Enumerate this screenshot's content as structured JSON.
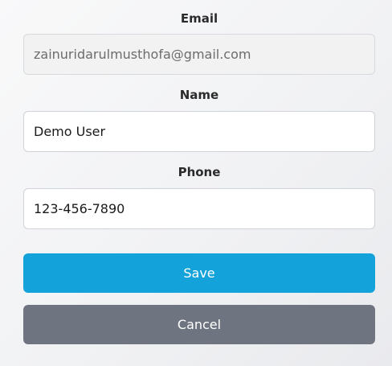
{
  "form": {
    "email": {
      "label": "Email",
      "value": "zainuridarulmusthofa@gmail.com"
    },
    "name": {
      "label": "Name",
      "value": "Demo User"
    },
    "phone": {
      "label": "Phone",
      "value": "123-456-7890"
    },
    "save_label": "Save",
    "cancel_label": "Cancel"
  },
  "colors": {
    "save_button": "#13a2d9",
    "cancel_button": "#6e7580",
    "readonly_field_bg": "#f2f2f2"
  }
}
